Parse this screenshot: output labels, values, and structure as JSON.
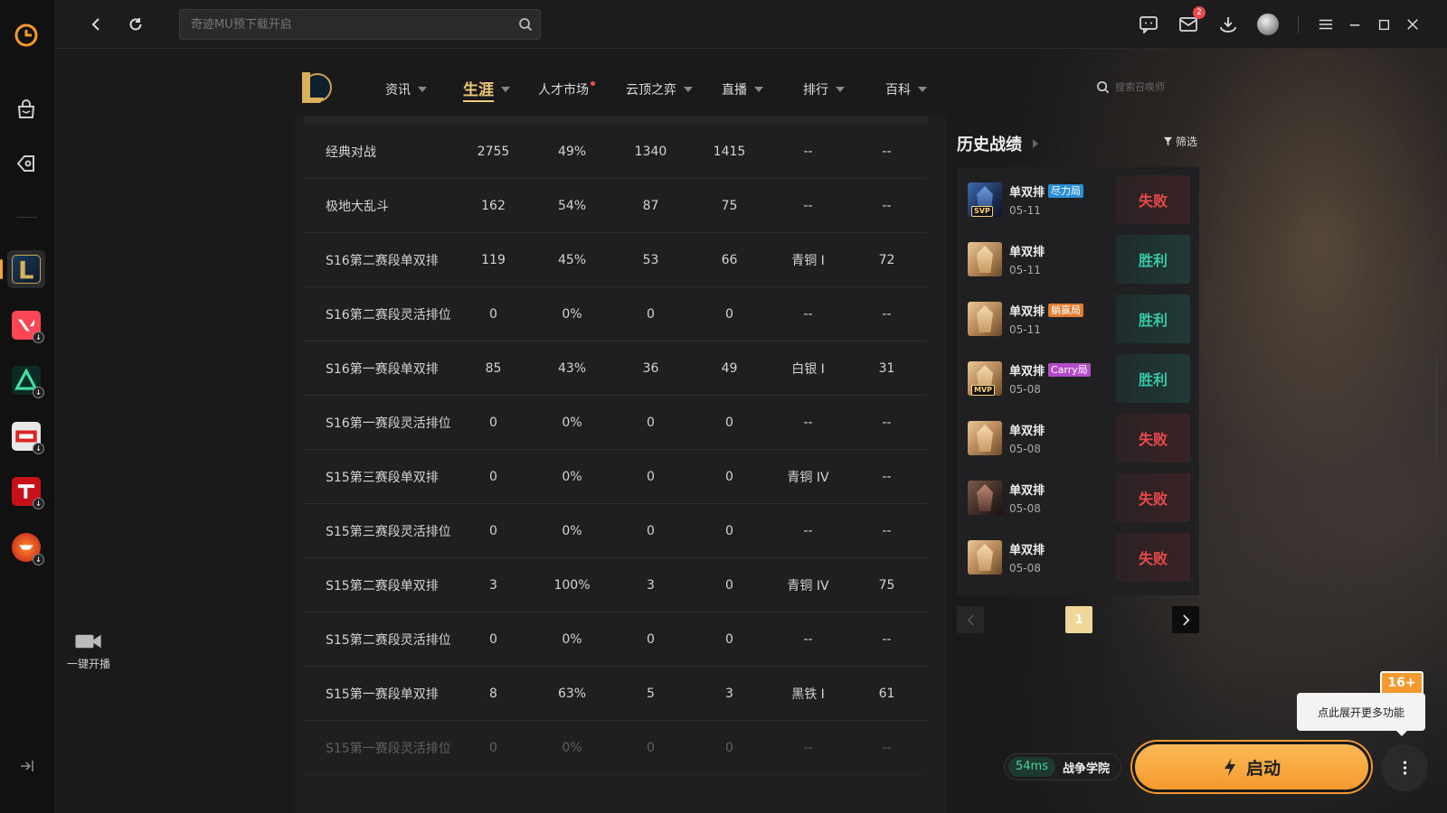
{
  "topbar": {
    "search_placeholder": "奇迹MU预下载开启",
    "mail_count": "2"
  },
  "nav": {
    "items": [
      {
        "label": "资讯"
      },
      {
        "label": "生涯"
      },
      {
        "label": "人才市场"
      },
      {
        "label": "云顶之弈"
      },
      {
        "label": "直播"
      },
      {
        "label": "排行"
      },
      {
        "label": "百科"
      }
    ],
    "summoner_search": "搜索召唤师"
  },
  "stats": {
    "rows": [
      {
        "mode": "经典对战",
        "total": "2755",
        "winrate": "49%",
        "wins": "1340",
        "losses": "1415",
        "rank": "--",
        "points": "--"
      },
      {
        "mode": "极地大乱斗",
        "total": "162",
        "winrate": "54%",
        "wins": "87",
        "losses": "75",
        "rank": "--",
        "points": "--"
      },
      {
        "mode": "S16第二赛段单双排",
        "total": "119",
        "winrate": "45%",
        "wins": "53",
        "losses": "66",
        "rank": "青铜 I",
        "points": "72"
      },
      {
        "mode": "S16第二赛段灵活排位",
        "total": "0",
        "winrate": "0%",
        "wins": "0",
        "losses": "0",
        "rank": "--",
        "points": "--"
      },
      {
        "mode": "S16第一赛段单双排",
        "total": "85",
        "winrate": "43%",
        "wins": "36",
        "losses": "49",
        "rank": "白银 I",
        "points": "31"
      },
      {
        "mode": "S16第一赛段灵活排位",
        "total": "0",
        "winrate": "0%",
        "wins": "0",
        "losses": "0",
        "rank": "--",
        "points": "--"
      },
      {
        "mode": "S15第三赛段单双排",
        "total": "0",
        "winrate": "0%",
        "wins": "0",
        "losses": "0",
        "rank": "青铜 IV",
        "points": "--"
      },
      {
        "mode": "S15第三赛段灵活排位",
        "total": "0",
        "winrate": "0%",
        "wins": "0",
        "losses": "0",
        "rank": "--",
        "points": "--"
      },
      {
        "mode": "S15第二赛段单双排",
        "total": "3",
        "winrate": "100%",
        "wins": "3",
        "losses": "0",
        "rank": "青铜 IV",
        "points": "75"
      },
      {
        "mode": "S15第二赛段灵活排位",
        "total": "0",
        "winrate": "0%",
        "wins": "0",
        "losses": "0",
        "rank": "--",
        "points": "--"
      },
      {
        "mode": "S15第一赛段单双排",
        "total": "8",
        "winrate": "63%",
        "wins": "5",
        "losses": "3",
        "rank": "黑铁 I",
        "points": "61"
      },
      {
        "mode": "S15第一赛段灵活排位",
        "total": "0",
        "winrate": "0%",
        "wins": "0",
        "losses": "0",
        "rank": "--",
        "points": "--"
      }
    ]
  },
  "history": {
    "title": "历史战绩",
    "filter_label": "筛选",
    "matches": [
      {
        "mode": "单双排",
        "tag": "尽力局",
        "badge": "SVP",
        "date": "05-11",
        "result": "失败"
      },
      {
        "mode": "单双排",
        "tag": "",
        "badge": "",
        "date": "05-11",
        "result": "胜利"
      },
      {
        "mode": "单双排",
        "tag": "躺赢局",
        "badge": "",
        "date": "05-11",
        "result": "胜利"
      },
      {
        "mode": "单双排",
        "tag": "Carry局",
        "badge": "MVP",
        "date": "05-08",
        "result": "胜利"
      },
      {
        "mode": "单双排",
        "tag": "",
        "badge": "",
        "date": "05-08",
        "result": "失败"
      },
      {
        "mode": "单双排",
        "tag": "",
        "badge": "",
        "date": "05-08",
        "result": "失败"
      },
      {
        "mode": "单双排",
        "tag": "",
        "badge": "",
        "date": "05-08",
        "result": "失败"
      }
    ],
    "current_page": "1"
  },
  "sidebar": {
    "live_label": "一键开播"
  },
  "bottom": {
    "ping": "54ms",
    "region": "战争学院",
    "launch_label": "启动",
    "tooltip": "点此展开更多功能",
    "age_rating": "16+"
  },
  "colors": {
    "accent": "#f1c878",
    "launch": "#f59a2e",
    "win": "#35c8a8",
    "lose": "#ea4a4a"
  }
}
